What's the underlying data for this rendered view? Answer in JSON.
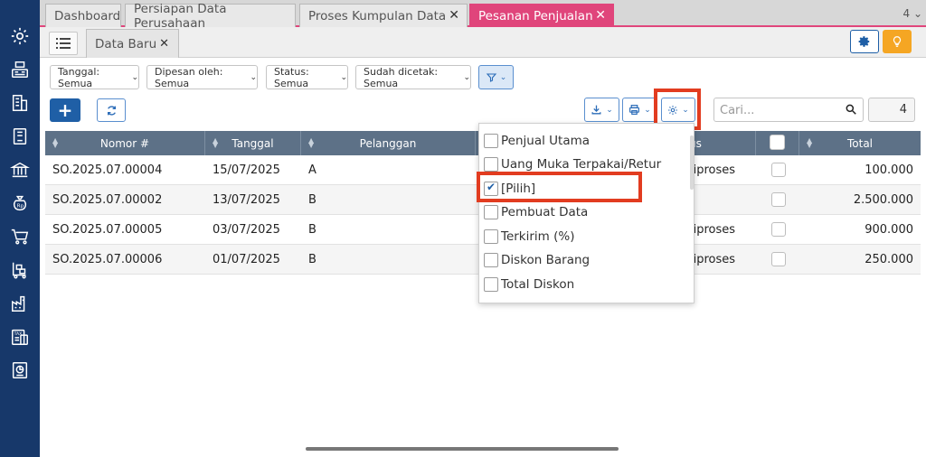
{
  "tabs": [
    {
      "label": "Dashboard",
      "closable": false,
      "active": false
    },
    {
      "label": "Persiapan Data Perusahaan",
      "closable": false,
      "active": false
    },
    {
      "label": "Proses Kumpulan Data",
      "closable": true,
      "active": false
    },
    {
      "label": "Pesanan Penjualan",
      "closable": true,
      "active": true
    }
  ],
  "tab_count": "4",
  "subtab": {
    "label": "Data Baru"
  },
  "filters": [
    {
      "label": "Tanggal: Semua"
    },
    {
      "label": "Dipesan oleh: Semua"
    },
    {
      "label": "Status: Semua"
    },
    {
      "label": "Sudah dicetak: Semua"
    }
  ],
  "search": {
    "placeholder": "Cari..."
  },
  "record_count": "4",
  "table": {
    "columns": [
      "Nomor #",
      "Tanggal",
      "Pelanggan",
      "us",
      "Total"
    ],
    "rows": [
      {
        "nomor": "SO.2025.07.00004",
        "tanggal": "15/07/2025",
        "pelanggan": "A",
        "status": "liproses",
        "total": "100.000"
      },
      {
        "nomor": "SO.2025.07.00002",
        "tanggal": "13/07/2025",
        "pelanggan": "B",
        "status": "",
        "total": "2.500.000"
      },
      {
        "nomor": "SO.2025.07.00005",
        "tanggal": "03/07/2025",
        "pelanggan": "B",
        "status": "liproses",
        "total": "900.000"
      },
      {
        "nomor": "SO.2025.07.00006",
        "tanggal": "01/07/2025",
        "pelanggan": "B",
        "status": "liproses",
        "total": "250.000"
      }
    ]
  },
  "column_menu": {
    "items": [
      {
        "label": "Penjual Utama",
        "checked": false
      },
      {
        "label": "Uang Muka Terpakai/Retur",
        "checked": false
      },
      {
        "label": "[Pilih]",
        "checked": true
      },
      {
        "label": "Pembuat Data",
        "checked": false
      },
      {
        "label": "Terkirim (%)",
        "checked": false
      },
      {
        "label": "Diskon Barang",
        "checked": false
      },
      {
        "label": "Total Diskon",
        "checked": false
      }
    ]
  },
  "colors": {
    "sidebar": "#17386a",
    "accent_tab": "#e0457b",
    "primary": "#1f5fa6",
    "highlight": "#e23c20",
    "header": "#5d7187",
    "idea": "#f5a623"
  }
}
